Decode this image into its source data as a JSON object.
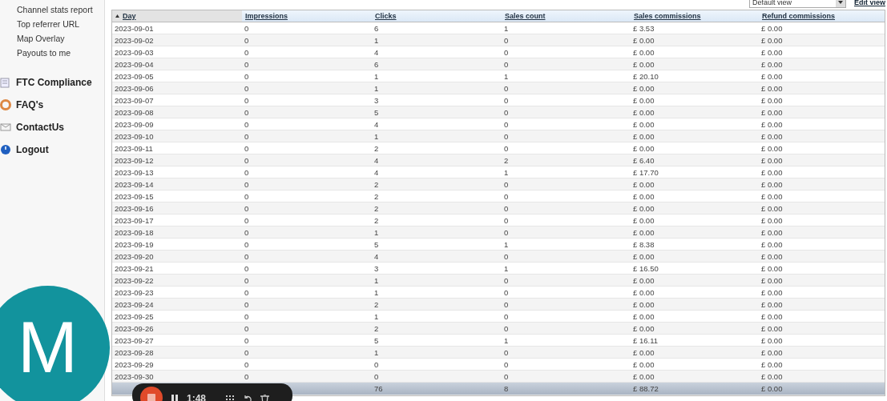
{
  "sidebar": {
    "links": [
      {
        "label": "Channel stats report"
      },
      {
        "label": "Top referrer URL"
      },
      {
        "label": "Map Overlay"
      },
      {
        "label": "Payouts to me"
      }
    ],
    "sections": [
      {
        "label": "FTC Compliance",
        "kind": "document"
      },
      {
        "label": "FAQ's",
        "kind": "lifebuoy"
      },
      {
        "label": "ContactUs",
        "kind": "envelope"
      },
      {
        "label": "Logout",
        "kind": "power"
      }
    ]
  },
  "view_bar": {
    "view_select": "Default view",
    "edit_link": "Edit view"
  },
  "table": {
    "columns": [
      {
        "label": "Day",
        "sorted": true
      },
      {
        "label": "Impressions",
        "sorted": false
      },
      {
        "label": "Clicks",
        "sorted": false
      },
      {
        "label": "Sales count",
        "sorted": false
      },
      {
        "label": "Sales commissions",
        "sorted": false
      },
      {
        "label": "Refund commissions",
        "sorted": false
      }
    ],
    "rows": [
      [
        "2023-09-01",
        "0",
        "6",
        "1",
        "£ 3.53",
        "£ 0.00"
      ],
      [
        "2023-09-02",
        "0",
        "1",
        "0",
        "£ 0.00",
        "£ 0.00"
      ],
      [
        "2023-09-03",
        "0",
        "4",
        "0",
        "£ 0.00",
        "£ 0.00"
      ],
      [
        "2023-09-04",
        "0",
        "6",
        "0",
        "£ 0.00",
        "£ 0.00"
      ],
      [
        "2023-09-05",
        "0",
        "1",
        "1",
        "£ 20.10",
        "£ 0.00"
      ],
      [
        "2023-09-06",
        "0",
        "1",
        "0",
        "£ 0.00",
        "£ 0.00"
      ],
      [
        "2023-09-07",
        "0",
        "3",
        "0",
        "£ 0.00",
        "£ 0.00"
      ],
      [
        "2023-09-08",
        "0",
        "5",
        "0",
        "£ 0.00",
        "£ 0.00"
      ],
      [
        "2023-09-09",
        "0",
        "4",
        "0",
        "£ 0.00",
        "£ 0.00"
      ],
      [
        "2023-09-10",
        "0",
        "1",
        "0",
        "£ 0.00",
        "£ 0.00"
      ],
      [
        "2023-09-11",
        "0",
        "2",
        "0",
        "£ 0.00",
        "£ 0.00"
      ],
      [
        "2023-09-12",
        "0",
        "4",
        "2",
        "£ 6.40",
        "£ 0.00"
      ],
      [
        "2023-09-13",
        "0",
        "4",
        "1",
        "£ 17.70",
        "£ 0.00"
      ],
      [
        "2023-09-14",
        "0",
        "2",
        "0",
        "£ 0.00",
        "£ 0.00"
      ],
      [
        "2023-09-15",
        "0",
        "2",
        "0",
        "£ 0.00",
        "£ 0.00"
      ],
      [
        "2023-09-16",
        "0",
        "2",
        "0",
        "£ 0.00",
        "£ 0.00"
      ],
      [
        "2023-09-17",
        "0",
        "2",
        "0",
        "£ 0.00",
        "£ 0.00"
      ],
      [
        "2023-09-18",
        "0",
        "1",
        "0",
        "£ 0.00",
        "£ 0.00"
      ],
      [
        "2023-09-19",
        "0",
        "5",
        "1",
        "£ 8.38",
        "£ 0.00"
      ],
      [
        "2023-09-20",
        "0",
        "4",
        "0",
        "£ 0.00",
        "£ 0.00"
      ],
      [
        "2023-09-21",
        "0",
        "3",
        "1",
        "£ 16.50",
        "£ 0.00"
      ],
      [
        "2023-09-22",
        "0",
        "1",
        "0",
        "£ 0.00",
        "£ 0.00"
      ],
      [
        "2023-09-23",
        "0",
        "1",
        "0",
        "£ 0.00",
        "£ 0.00"
      ],
      [
        "2023-09-24",
        "0",
        "2",
        "0",
        "£ 0.00",
        "£ 0.00"
      ],
      [
        "2023-09-25",
        "0",
        "1",
        "0",
        "£ 0.00",
        "£ 0.00"
      ],
      [
        "2023-09-26",
        "0",
        "2",
        "0",
        "£ 0.00",
        "£ 0.00"
      ],
      [
        "2023-09-27",
        "0",
        "5",
        "1",
        "£ 16.11",
        "£ 0.00"
      ],
      [
        "2023-09-28",
        "0",
        "1",
        "0",
        "£ 0.00",
        "£ 0.00"
      ],
      [
        "2023-09-29",
        "0",
        "0",
        "0",
        "£ 0.00",
        "£ 0.00"
      ],
      [
        "2023-09-30",
        "0",
        "0",
        "0",
        "£ 0.00",
        "£ 0.00"
      ]
    ],
    "totals": {
      "clicks": "76",
      "sales_count": "8",
      "sales_commissions": "£ 88.72",
      "refund_commissions": "£ 0.00"
    }
  },
  "webcam_bubble": {
    "initial": "M"
  },
  "recorder": {
    "time": "1:48"
  }
}
